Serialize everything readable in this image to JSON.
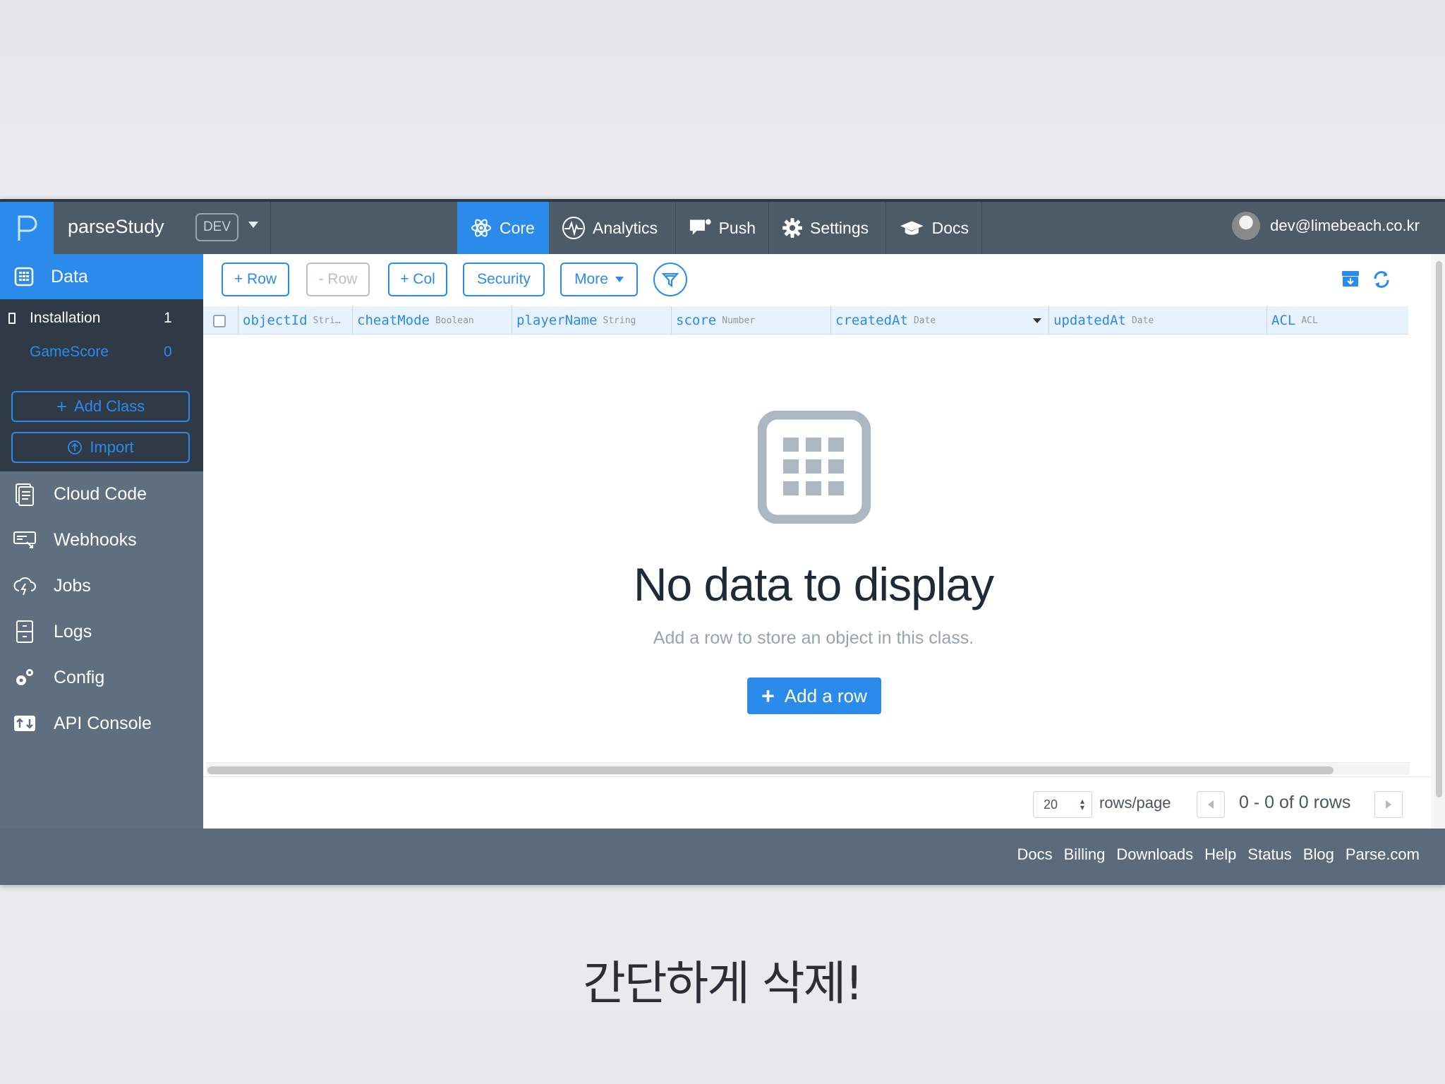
{
  "topnav": {
    "app_name": "parseStudy",
    "env_badge": "DEV",
    "tabs": [
      {
        "label": "Core"
      },
      {
        "label": "Analytics"
      },
      {
        "label": "Push"
      },
      {
        "label": "Settings"
      },
      {
        "label": "Docs"
      }
    ],
    "user_email": "dev@limebeach.co.kr"
  },
  "sidebar": {
    "data_label": "Data",
    "classes": [
      {
        "name": "Installation",
        "count": "1"
      },
      {
        "name": "GameScore",
        "count": "0"
      }
    ],
    "add_class_label": "Add Class",
    "import_label": "Import",
    "items": [
      {
        "label": "Cloud Code"
      },
      {
        "label": "Webhooks"
      },
      {
        "label": "Jobs"
      },
      {
        "label": "Logs"
      },
      {
        "label": "Config"
      },
      {
        "label": "API Console"
      }
    ]
  },
  "toolbar": {
    "add_row": "+ Row",
    "remove_row": "- Row",
    "add_col": "+ Col",
    "security": "Security",
    "more": "More"
  },
  "columns": [
    {
      "name": "objectId",
      "type": "Stri…"
    },
    {
      "name": "cheatMode",
      "type": "Boolean"
    },
    {
      "name": "playerName",
      "type": "String"
    },
    {
      "name": "score",
      "type": "Number"
    },
    {
      "name": "createdAt",
      "type": "Date"
    },
    {
      "name": "updatedAt",
      "type": "Date"
    },
    {
      "name": "ACL",
      "type": "ACL"
    }
  ],
  "empty_state": {
    "title": "No data to display",
    "description": "Add a row to store an object in this class.",
    "add_row_label": "Add a row"
  },
  "pagination": {
    "rows_per_page": "20",
    "rows_per_page_label": "rows/page",
    "info": "0 - 0 of 0 rows"
  },
  "footer_links": [
    "Docs",
    "Billing",
    "Downloads",
    "Help",
    "Status",
    "Blog",
    "Parse.com"
  ],
  "caption": "간단하게 삭제!",
  "colors": {
    "accent": "#2b8bea",
    "nav": "#4d5b69",
    "sidebar": "#5f6f80",
    "sidebar_dark": "#2f3a46"
  }
}
